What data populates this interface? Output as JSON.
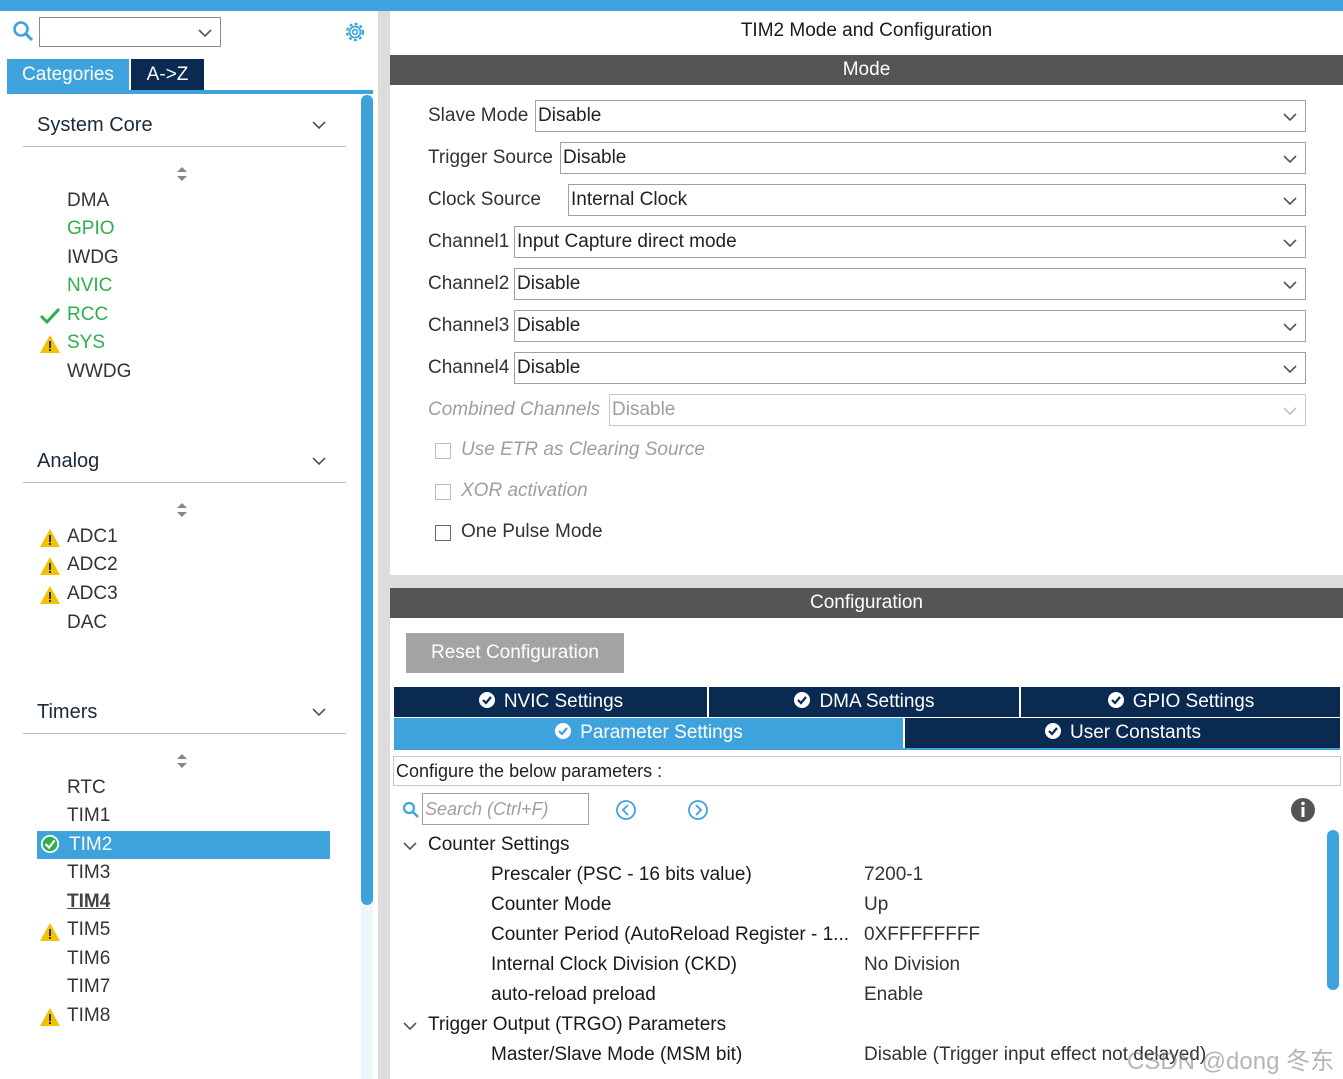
{
  "left": {
    "search_value": "",
    "tabs": [
      "Categories",
      "A->Z"
    ],
    "sections": [
      {
        "title": "System Core",
        "items": [
          {
            "label": "DMA",
            "status": "none",
            "color": "normal"
          },
          {
            "label": "GPIO",
            "status": "none",
            "color": "green"
          },
          {
            "label": "IWDG",
            "status": "none",
            "color": "normal"
          },
          {
            "label": "NVIC",
            "status": "none",
            "color": "green"
          },
          {
            "label": "RCC",
            "status": "check",
            "color": "green"
          },
          {
            "label": "SYS",
            "status": "warning",
            "color": "green"
          },
          {
            "label": "WWDG",
            "status": "none",
            "color": "normal"
          }
        ]
      },
      {
        "title": "Analog",
        "items": [
          {
            "label": "ADC1",
            "status": "warning",
            "color": "normal"
          },
          {
            "label": "ADC2",
            "status": "warning",
            "color": "normal"
          },
          {
            "label": "ADC3",
            "status": "warning",
            "color": "normal"
          },
          {
            "label": "DAC",
            "status": "none",
            "color": "normal"
          }
        ]
      },
      {
        "title": "Timers",
        "items": [
          {
            "label": "RTC",
            "status": "none",
            "color": "normal"
          },
          {
            "label": "TIM1",
            "status": "none",
            "color": "normal"
          },
          {
            "label": "TIM2",
            "status": "selected",
            "color": "white"
          },
          {
            "label": "TIM3",
            "status": "none",
            "color": "normal"
          },
          {
            "label": "TIM4",
            "status": "underline",
            "color": "normal"
          },
          {
            "label": "TIM5",
            "status": "warning",
            "color": "normal"
          },
          {
            "label": "TIM6",
            "status": "none",
            "color": "normal"
          },
          {
            "label": "TIM7",
            "status": "none",
            "color": "normal"
          },
          {
            "label": "TIM8",
            "status": "warning",
            "color": "normal"
          }
        ]
      }
    ]
  },
  "right": {
    "title": "TIM2 Mode and Configuration",
    "mode_bar": "Mode",
    "mode_rows": [
      {
        "label": "Slave Mode",
        "value": "Disable",
        "disabled": false
      },
      {
        "label": "Trigger Source",
        "value": "Disable",
        "disabled": false
      },
      {
        "label": "Clock Source",
        "value": "Internal Clock",
        "disabled": false
      },
      {
        "label": "Channel1",
        "value": "Input Capture direct mode",
        "disabled": false
      },
      {
        "label": "Channel2",
        "value": "Disable",
        "disabled": false
      },
      {
        "label": "Channel3",
        "value": "Disable",
        "disabled": false
      },
      {
        "label": "Channel4",
        "value": "Disable",
        "disabled": false
      },
      {
        "label": "Combined Channels",
        "value": "Disable",
        "disabled": true
      }
    ],
    "checkboxes": [
      {
        "label": "Use ETR as Clearing Source",
        "disabled": true,
        "checked": false
      },
      {
        "label": "XOR activation",
        "disabled": true,
        "checked": false
      },
      {
        "label": "One Pulse Mode",
        "disabled": false,
        "checked": false
      }
    ],
    "config_bar": "Configuration",
    "reset_label": "Reset Configuration",
    "tabs_row1": [
      "NVIC Settings",
      "DMA Settings",
      "GPIO Settings"
    ],
    "tabs_row2": [
      "Parameter Settings",
      "User Constants"
    ],
    "active_tab": "Parameter Settings",
    "description": "Configure the below parameters :",
    "search_placeholder": "Search (Ctrl+F)",
    "groups": [
      {
        "title": "Counter Settings",
        "params": [
          {
            "name": "Prescaler (PSC - 16 bits value)",
            "value": "7200-1"
          },
          {
            "name": "Counter Mode",
            "value": "Up"
          },
          {
            "name": "Counter Period (AutoReload Register - 1...",
            "value": "0XFFFFFFFF"
          },
          {
            "name": "Internal Clock Division (CKD)",
            "value": "No Division"
          },
          {
            "name": "auto-reload preload",
            "value": "Enable"
          }
        ]
      },
      {
        "title": "Trigger Output (TRGO) Parameters",
        "params": [
          {
            "name": "Master/Slave Mode (MSM bit)",
            "value": "Disable (Trigger input effect not delayed)"
          }
        ]
      }
    ],
    "watermark": "CSDN @dong 冬东"
  },
  "colors": {
    "accent": "#3ea3dc",
    "dark_tab": "#0b2a52",
    "bar": "#555555",
    "ok_green": "#2fae4d",
    "warning": "#f2c200"
  }
}
